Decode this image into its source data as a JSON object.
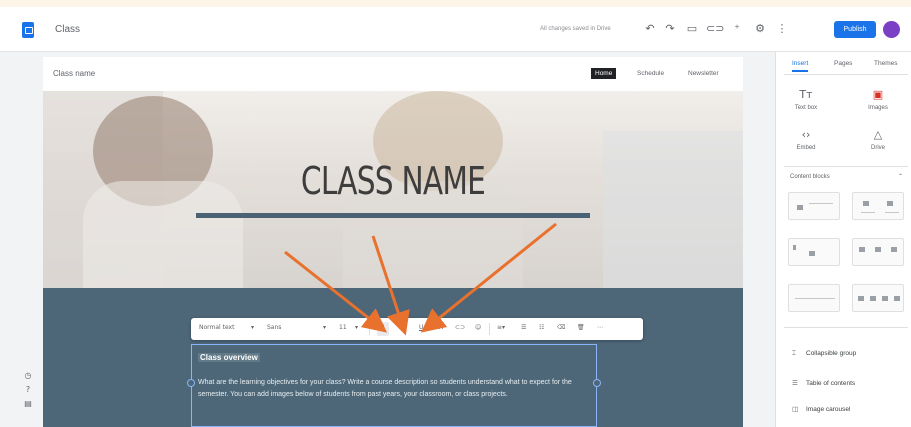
{
  "app": {
    "document_title": "Class",
    "save_status": "All changes saved in Drive",
    "publish_label": "Publish",
    "avatar_initial": "",
    "toolbar_icons": [
      "undo-icon",
      "redo-icon",
      "preview-icon",
      "link-icon",
      "add-person-icon",
      "settings-icon",
      "more-icon"
    ]
  },
  "site": {
    "name": "Class name",
    "nav": [
      {
        "label": "Home",
        "active": true
      },
      {
        "label": "Schedule",
        "active": false
      },
      {
        "label": "Newsletter",
        "active": false
      }
    ],
    "hero_title": "CLASS NAME"
  },
  "format_toolbar": {
    "style_select": "Normal text",
    "font_select": "Sans",
    "size_select": "11",
    "items": [
      "bold-icon",
      "italic-icon",
      "underline-icon",
      "text-color-icon",
      "link-icon",
      "emoji-icon",
      "align-icon",
      "bulleted-list-icon",
      "numbered-list-icon",
      "clear-format-icon",
      "delete-icon",
      "more-icon"
    ]
  },
  "text_box": {
    "heading": "Class overview",
    "body": "What are the learning objectives for your class? Write a course description so students understand what to expect for the semester. You can add images below of students from past years, your classroom, or class projects."
  },
  "panel": {
    "tabs": [
      {
        "label": "Insert",
        "active": true
      },
      {
        "label": "Pages",
        "active": false
      },
      {
        "label": "Themes",
        "active": false
      }
    ],
    "insert_tiles": [
      {
        "label": "Text box",
        "icon": "text-box-icon"
      },
      {
        "label": "Images",
        "icon": "image-icon"
      },
      {
        "label": "Embed",
        "icon": "embed-icon"
      },
      {
        "label": "Drive",
        "icon": "drive-icon"
      }
    ],
    "layouts_label": "Content blocks",
    "components": [
      {
        "label": "Collapsible group",
        "icon": "collapsible-icon"
      },
      {
        "label": "Table of contents",
        "icon": "toc-icon"
      },
      {
        "label": "Image carousel",
        "icon": "carousel-icon"
      }
    ]
  },
  "colors": {
    "accent": "#1a73e8",
    "band": "#4d6778",
    "annotation_arrow": "#e8712e"
  }
}
